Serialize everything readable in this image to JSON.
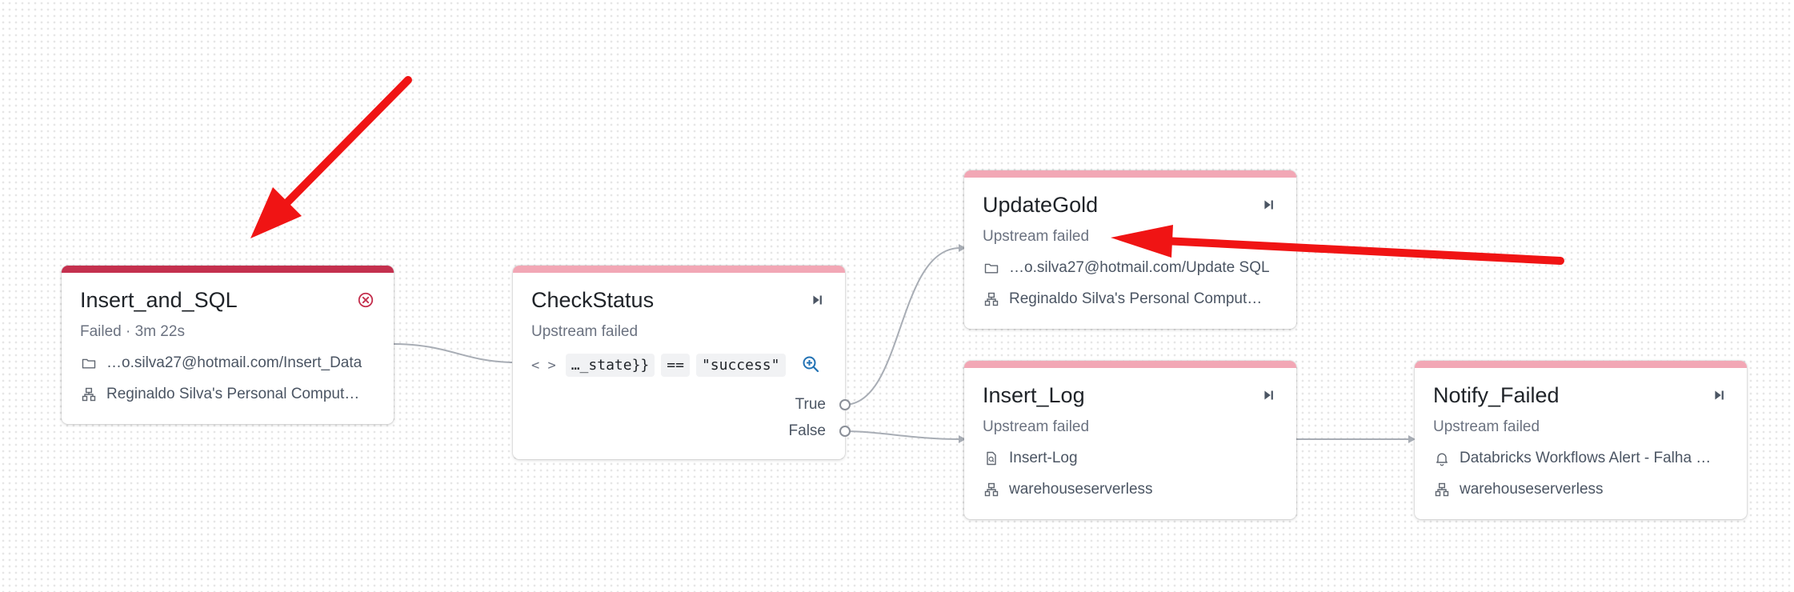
{
  "nodes": {
    "insert_and_sql": {
      "title": "Insert_and_SQL",
      "status": "Failed · 3m 22s",
      "path": "…o.silva27@hotmail.com/Insert_Data",
      "compute": "Reginaldo Silva's Personal Comput…",
      "action_icon": "failed-x-circle-icon"
    },
    "check_status": {
      "title": "CheckStatus",
      "status": "Upstream failed",
      "brackets": "< >",
      "lhs": "…_state}}",
      "op": "==",
      "rhs": "\"success\"",
      "true_label": "True",
      "false_label": "False",
      "action_icon": "run-task-icon"
    },
    "update_gold": {
      "title": "UpdateGold",
      "status": "Upstream failed",
      "path": "…o.silva27@hotmail.com/Update SQL",
      "compute": "Reginaldo Silva's Personal Comput…",
      "action_icon": "run-task-icon"
    },
    "insert_log": {
      "title": "Insert_Log",
      "status": "Upstream failed",
      "query": "Insert-Log",
      "compute": "warehouseserverless",
      "action_icon": "run-task-icon"
    },
    "notify_failed": {
      "title": "Notify_Failed",
      "status": "Upstream failed",
      "alert": "Databricks Workflows Alert - Falha …",
      "compute": "warehouseserverless",
      "action_icon": "run-task-icon"
    }
  },
  "colors": {
    "failed_bar": "#c4304e",
    "upstream_failed_bar": "#f2a7b5",
    "failed_icon": "#c4304e",
    "edge": "#a8adb5",
    "annotation_arrow": "#f01414",
    "zoom_icon": "#2272b4"
  },
  "annotations": [
    "red-arrow-to-insert-and-sql",
    "red-arrow-to-updategold-status"
  ]
}
